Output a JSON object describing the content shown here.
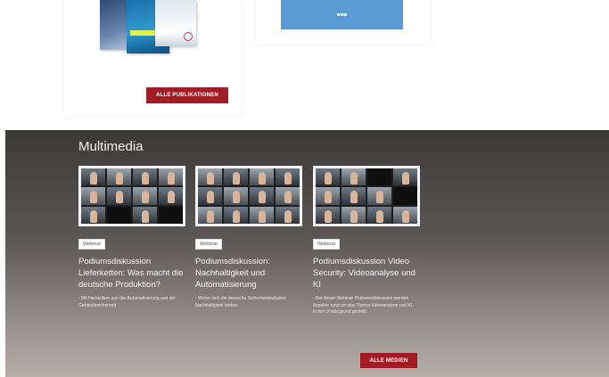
{
  "publications": {
    "button_label": "ALLE PUBLIKATIONEN"
  },
  "more_card": {
    "button_label": "•••"
  },
  "multimedia": {
    "title": "Multimedia",
    "items": [
      {
        "badge": "Webinar",
        "title": "Podiumsdiskussion Lieferketten: Was macht die deutsche Produktion?",
        "desc": "- Mit Herstellern aus der Automatisierung und der Gebäudesicherheit"
      },
      {
        "badge": "Webinar",
        "title": "Podiumsdiskussion: Nachhaltigkeit und Automatisierung",
        "desc": "- Wohin sich die deutsche Sicherheitsindustrie Nachhaltigkeit lenken"
      },
      {
        "badge": "Webinar",
        "title": "Podiumsdiskussion Video Security: Videoanalyse und KI",
        "desc": "- Bei dieser Webinar Podiumsdiskussion werden Aspekte rund um das Thema Videoanalyse und KI in den Vordergrund gestellt."
      }
    ],
    "button_label": "ALLE MEDIEN"
  },
  "colors": {
    "accent_red": "#a01d25",
    "button_blue": "#5b9bd5"
  }
}
